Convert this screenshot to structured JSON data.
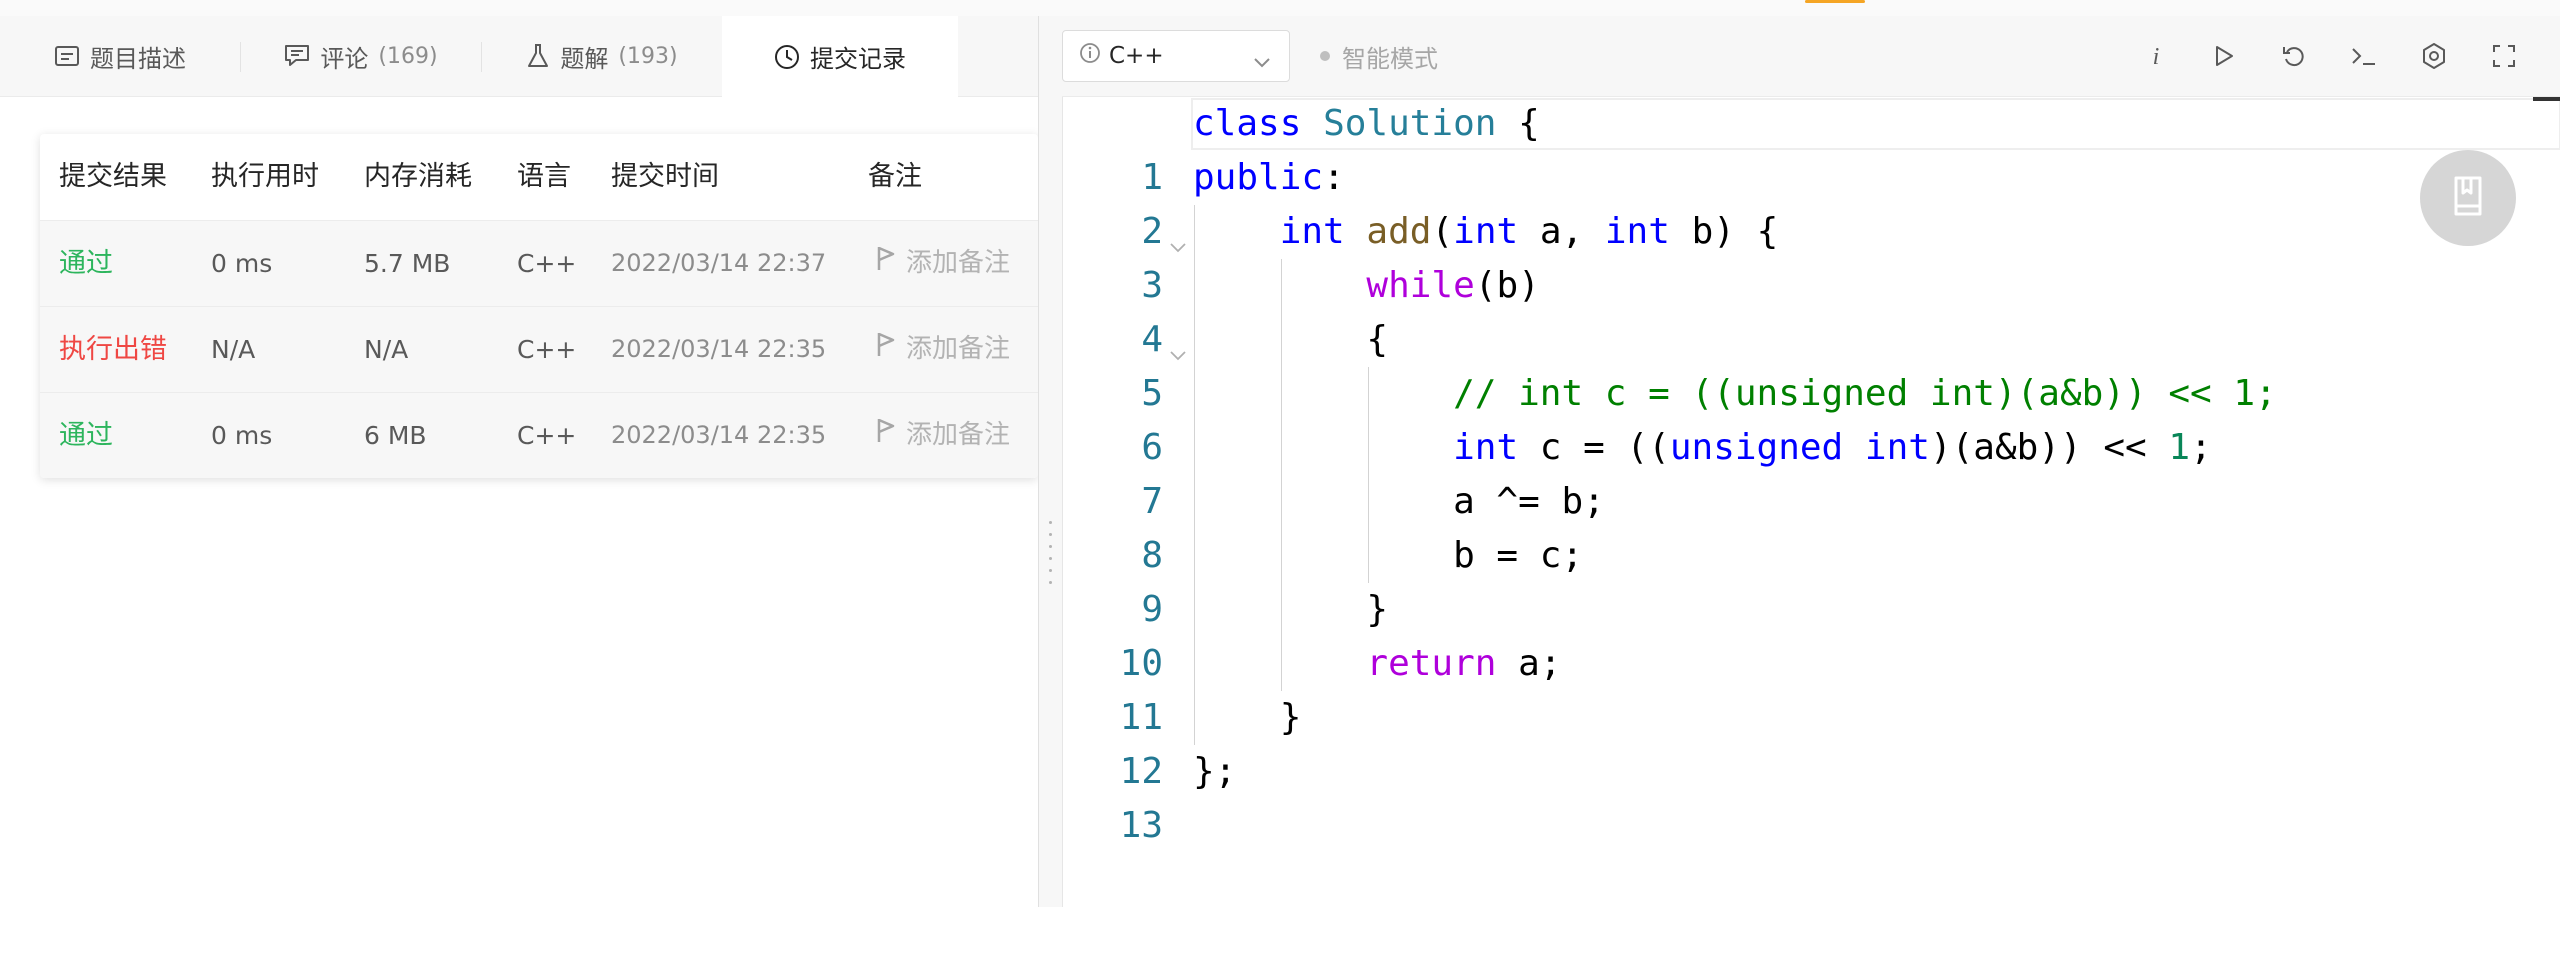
{
  "tabs": [
    {
      "label": "题目描述",
      "count": "",
      "icon": "description-icon",
      "active": false
    },
    {
      "label": "评论",
      "count": "(169)",
      "icon": "comment-icon",
      "active": false
    },
    {
      "label": "题解",
      "count": "(193)",
      "icon": "flask-icon",
      "active": false
    },
    {
      "label": "提交记录",
      "count": "",
      "icon": "clock-icon",
      "active": true
    }
  ],
  "submissions": {
    "headers": [
      "提交结果",
      "执行用时",
      "内存消耗",
      "语言",
      "提交时间",
      "备注"
    ],
    "rows": [
      {
        "status": "通过",
        "status_type": "pass",
        "runtime": "0 ms",
        "memory": "5.7 MB",
        "language": "C++",
        "time": "2022/03/14 22:37",
        "note": "添加备注"
      },
      {
        "status": "执行出错",
        "status_type": "fail",
        "runtime": "N/A",
        "memory": "N/A",
        "language": "C++",
        "time": "2022/03/14 22:35",
        "note": "添加备注"
      },
      {
        "status": "通过",
        "status_type": "pass",
        "runtime": "0 ms",
        "memory": "6 MB",
        "language": "C++",
        "time": "2022/03/14 22:35",
        "note": "添加备注"
      }
    ]
  },
  "editor": {
    "language": "C++",
    "smart_mode": "智能模式",
    "toolbar_icons": [
      "info-icon",
      "run-icon",
      "reset-icon",
      "console-icon",
      "settings-icon",
      "fullscreen-icon"
    ],
    "code_lines": [
      {
        "no": "1",
        "text": "class Solution {"
      },
      {
        "no": "2",
        "text": "public:"
      },
      {
        "no": "3",
        "text": "    int add(int a, int b) {"
      },
      {
        "no": "4",
        "text": "        while(b)"
      },
      {
        "no": "5",
        "text": "        {"
      },
      {
        "no": "6",
        "text": "            // int c = ((unsigned int)(a&b)) << 1;"
      },
      {
        "no": "7",
        "text": "            int c = ((unsigned int)(a&b)) << 1;"
      },
      {
        "no": "8",
        "text": "            a ^= b;"
      },
      {
        "no": "9",
        "text": "            b = c;"
      },
      {
        "no": "10",
        "text": "        }"
      },
      {
        "no": "11",
        "text": "        return a;"
      },
      {
        "no": "12",
        "text": "    }"
      },
      {
        "no": "13",
        "text": "};"
      }
    ]
  },
  "colors": {
    "pass": "#2db55d",
    "fail": "#ef4743",
    "keyword": "#0000ff",
    "type": "#267f99",
    "function": "#795e26",
    "control": "#af00db",
    "comment": "#008000",
    "number": "#098658",
    "line_number": "#237893"
  }
}
